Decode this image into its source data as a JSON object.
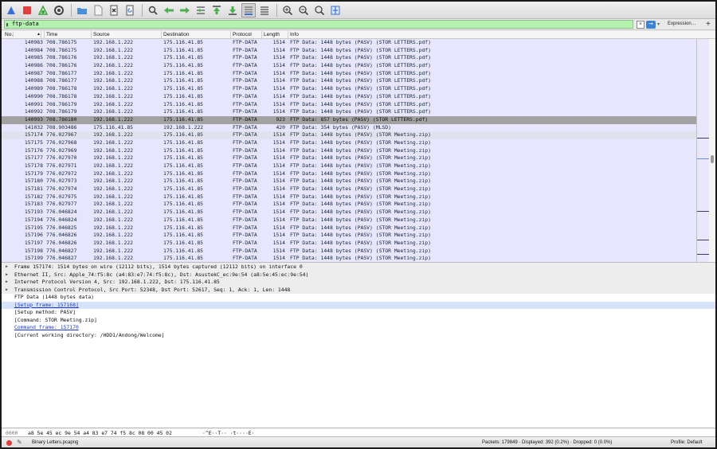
{
  "toolbar": {
    "buttons": [
      {
        "name": "shark-fin-start-icon",
        "color": "#3b6fd6"
      },
      {
        "name": "stop-capture-icon",
        "color": "#e04040"
      },
      {
        "name": "restart-capture-icon",
        "color": "#3aa63a"
      },
      {
        "name": "capture-options-icon",
        "color": "#444444"
      },
      {
        "name": "open-folder-icon",
        "color": "#4a90d9"
      },
      {
        "name": "save-file-icon",
        "color": "#7a7a7a"
      },
      {
        "name": "close-file-icon",
        "color": "#555555"
      },
      {
        "name": "reload-file-icon",
        "color": "#4a90d9"
      },
      {
        "name": "find-packet-icon",
        "color": "#444444"
      },
      {
        "name": "go-back-icon",
        "color": "#4caf50"
      },
      {
        "name": "go-forward-icon",
        "color": "#4caf50"
      },
      {
        "name": "go-to-packet-icon",
        "color": "#4caf50"
      },
      {
        "name": "go-first-packet-icon",
        "color": "#4caf50"
      },
      {
        "name": "go-last-packet-icon",
        "color": "#4caf50"
      },
      {
        "name": "auto-scroll-icon",
        "color": "#444444"
      },
      {
        "name": "colorize-icon",
        "color": "#555555"
      },
      {
        "name": "zoom-in-icon",
        "color": "#444444"
      },
      {
        "name": "zoom-out-icon",
        "color": "#444444"
      },
      {
        "name": "zoom-normal-icon",
        "color": "#444444"
      },
      {
        "name": "resize-columns-icon",
        "color": "#3b6fd6"
      }
    ]
  },
  "filter": {
    "value": "ftp-data",
    "expression_label": "Expression…",
    "plus_label": "+"
  },
  "columns": {
    "no": "No.",
    "time": "Time",
    "source": "Source",
    "destination": "Destination",
    "protocol": "Protocol",
    "length": "Length",
    "info": "Info"
  },
  "packets": [
    {
      "no": "140983",
      "time": "708.786175",
      "src": "192.168.1.222",
      "dst": "175.116.41.85",
      "proto": "FTP-DATA",
      "len": "1514",
      "info": "FTP Data: 1448 bytes (PASV) (STOR LETTERS.pdf)"
    },
    {
      "no": "140984",
      "time": "708.786175",
      "src": "192.168.1.222",
      "dst": "175.116.41.85",
      "proto": "FTP-DATA",
      "len": "1514",
      "info": "FTP Data: 1448 bytes (PASV) (STOR LETTERS.pdf)"
    },
    {
      "no": "140985",
      "time": "708.786176",
      "src": "192.168.1.222",
      "dst": "175.116.41.85",
      "proto": "FTP-DATA",
      "len": "1514",
      "info": "FTP Data: 1448 bytes (PASV) (STOR LETTERS.pdf)"
    },
    {
      "no": "140986",
      "time": "708.786176",
      "src": "192.168.1.222",
      "dst": "175.116.41.85",
      "proto": "FTP-DATA",
      "len": "1514",
      "info": "FTP Data: 1448 bytes (PASV) (STOR LETTERS.pdf)"
    },
    {
      "no": "140987",
      "time": "708.786177",
      "src": "192.168.1.222",
      "dst": "175.116.41.85",
      "proto": "FTP-DATA",
      "len": "1514",
      "info": "FTP Data: 1448 bytes (PASV) (STOR LETTERS.pdf)"
    },
    {
      "no": "140988",
      "time": "708.786177",
      "src": "192.168.1.222",
      "dst": "175.116.41.85",
      "proto": "FTP-DATA",
      "len": "1514",
      "info": "FTP Data: 1448 bytes (PASV) (STOR LETTERS.pdf)"
    },
    {
      "no": "140989",
      "time": "708.786178",
      "src": "192.168.1.222",
      "dst": "175.116.41.85",
      "proto": "FTP-DATA",
      "len": "1514",
      "info": "FTP Data: 1448 bytes (PASV) (STOR LETTERS.pdf)"
    },
    {
      "no": "140990",
      "time": "708.786178",
      "src": "192.168.1.222",
      "dst": "175.116.41.85",
      "proto": "FTP-DATA",
      "len": "1514",
      "info": "FTP Data: 1448 bytes (PASV) (STOR LETTERS.pdf)"
    },
    {
      "no": "140991",
      "time": "708.786179",
      "src": "192.168.1.222",
      "dst": "175.116.41.85",
      "proto": "FTP-DATA",
      "len": "1514",
      "info": "FTP Data: 1448 bytes (PASV) (STOR LETTERS.pdf)"
    },
    {
      "no": "140992",
      "time": "708.786179",
      "src": "192.168.1.222",
      "dst": "175.116.41.85",
      "proto": "FTP-DATA",
      "len": "1514",
      "info": "FTP Data: 1448 bytes (PASV) (STOR LETTERS.pdf)"
    },
    {
      "no": "140993",
      "time": "708.786180",
      "src": "192.168.1.222",
      "dst": "175.116.41.85",
      "proto": "FTP-DATA",
      "len": "923",
      "info": "FTP Data: 857 bytes (PASV) (STOR LETTERS.pdf)"
    },
    {
      "no": "141032",
      "time": "708.903486",
      "src": "175.116.41.85",
      "dst": "192.168.1.222",
      "proto": "FTP-DATA",
      "len": "420",
      "info": "FTP Data: 354 bytes (PASV) (MLSD)"
    },
    {
      "no": "157174",
      "time": "776.027967",
      "src": "192.168.1.222",
      "dst": "175.116.41.85",
      "proto": "FTP-DATA",
      "len": "1514",
      "info": "FTP Data: 1448 bytes (PASV) (STOR Meeting.zip)"
    },
    {
      "no": "157175",
      "time": "776.027968",
      "src": "192.168.1.222",
      "dst": "175.116.41.85",
      "proto": "FTP-DATA",
      "len": "1514",
      "info": "FTP Data: 1448 bytes (PASV) (STOR Meeting.zip)"
    },
    {
      "no": "157176",
      "time": "776.027969",
      "src": "192.168.1.222",
      "dst": "175.116.41.85",
      "proto": "FTP-DATA",
      "len": "1514",
      "info": "FTP Data: 1448 bytes (PASV) (STOR Meeting.zip)"
    },
    {
      "no": "157177",
      "time": "776.027970",
      "src": "192.168.1.222",
      "dst": "175.116.41.85",
      "proto": "FTP-DATA",
      "len": "1514",
      "info": "FTP Data: 1448 bytes (PASV) (STOR Meeting.zip)"
    },
    {
      "no": "157178",
      "time": "776.027971",
      "src": "192.168.1.222",
      "dst": "175.116.41.85",
      "proto": "FTP-DATA",
      "len": "1514",
      "info": "FTP Data: 1448 bytes (PASV) (STOR Meeting.zip)"
    },
    {
      "no": "157179",
      "time": "776.027972",
      "src": "192.168.1.222",
      "dst": "175.116.41.85",
      "proto": "FTP-DATA",
      "len": "1514",
      "info": "FTP Data: 1448 bytes (PASV) (STOR Meeting.zip)"
    },
    {
      "no": "157180",
      "time": "776.027973",
      "src": "192.168.1.222",
      "dst": "175.116.41.85",
      "proto": "FTP-DATA",
      "len": "1514",
      "info": "FTP Data: 1448 bytes (PASV) (STOR Meeting.zip)"
    },
    {
      "no": "157181",
      "time": "776.027974",
      "src": "192.168.1.222",
      "dst": "175.116.41.85",
      "proto": "FTP-DATA",
      "len": "1514",
      "info": "FTP Data: 1448 bytes (PASV) (STOR Meeting.zip)"
    },
    {
      "no": "157182",
      "time": "776.027975",
      "src": "192.168.1.222",
      "dst": "175.116.41.85",
      "proto": "FTP-DATA",
      "len": "1514",
      "info": "FTP Data: 1448 bytes (PASV) (STOR Meeting.zip)"
    },
    {
      "no": "157183",
      "time": "776.027977",
      "src": "192.168.1.222",
      "dst": "175.116.41.85",
      "proto": "FTP-DATA",
      "len": "1514",
      "info": "FTP Data: 1448 bytes (PASV) (STOR Meeting.zip)"
    },
    {
      "no": "157193",
      "time": "776.046824",
      "src": "192.168.1.222",
      "dst": "175.116.41.85",
      "proto": "FTP-DATA",
      "len": "1514",
      "info": "FTP Data: 1448 bytes (PASV) (STOR Meeting.zip)"
    },
    {
      "no": "157194",
      "time": "776.046824",
      "src": "192.168.1.222",
      "dst": "175.116.41.85",
      "proto": "FTP-DATA",
      "len": "1514",
      "info": "FTP Data: 1448 bytes (PASV) (STOR Meeting.zip)"
    },
    {
      "no": "157195",
      "time": "776.046825",
      "src": "192.168.1.222",
      "dst": "175.116.41.85",
      "proto": "FTP-DATA",
      "len": "1514",
      "info": "FTP Data: 1448 bytes (PASV) (STOR Meeting.zip)"
    },
    {
      "no": "157196",
      "time": "776.046826",
      "src": "192.168.1.222",
      "dst": "175.116.41.85",
      "proto": "FTP-DATA",
      "len": "1514",
      "info": "FTP Data: 1448 bytes (PASV) (STOR Meeting.zip)"
    },
    {
      "no": "157197",
      "time": "776.046826",
      "src": "192.168.1.222",
      "dst": "175.116.41.85",
      "proto": "FTP-DATA",
      "len": "1514",
      "info": "FTP Data: 1448 bytes (PASV) (STOR Meeting.zip)"
    },
    {
      "no": "157198",
      "time": "776.046827",
      "src": "192.168.1.222",
      "dst": "175.116.41.85",
      "proto": "FTP-DATA",
      "len": "1514",
      "info": "FTP Data: 1448 bytes (PASV) (STOR Meeting.zip)"
    },
    {
      "no": "157199",
      "time": "776.046827",
      "src": "192.168.1.222",
      "dst": "175.116.41.85",
      "proto": "FTP-DATA",
      "len": "1514",
      "info": "FTP Data: 1448 bytes (PASV) (STOR Meeting.zip)"
    }
  ],
  "selected_packet_no": "140993",
  "current_packet_no": "157174",
  "row_colors": {
    "ftp_data": "#e7e6fe",
    "selected": "#a2a2a2",
    "link": "#1d39c9"
  },
  "details": [
    {
      "text": "Frame 157174: 1514 bytes on wire (12112 bits), 1514 bytes captured (12112 bits) on interface 0",
      "kind": "top"
    },
    {
      "text": "Ethernet II, Src: Apple_74:f5:8c (a4:83:e7:74:f5:8c), Dst: AsustekC_ec:9e:54 (a8:5e:45:ec:9e:54)",
      "kind": "top"
    },
    {
      "text": "Internet Protocol Version 4, Src: 192.168.1.222, Dst: 175.116.41.85",
      "kind": "top"
    },
    {
      "text": "Transmission Control Protocol, Src Port: 52348, Dst Port: 52617, Seq: 1, Ack: 1, Len: 1448",
      "kind": "top"
    },
    {
      "text": "FTP Data (1448 bytes data)",
      "kind": "plain"
    },
    {
      "text": "[Setup frame: 157168]",
      "kind": "link"
    },
    {
      "text": "[Setup method: PASV]",
      "kind": "plain"
    },
    {
      "text": "[Command: STOR Meeting.zip]",
      "kind": "plain"
    },
    {
      "text": "Command frame: 157170",
      "kind": "link"
    },
    {
      "text": "[Current working directory: /HDD1/Andong/Welcome]",
      "kind": "plain"
    }
  ],
  "bytes": {
    "offset": "0000",
    "hex": "a8 5e 45 ec 9e 54 a4 83  e7 74 f5 8c 08 00 45 02",
    "ascii": "·^E··T··  ·t····E·"
  },
  "status": {
    "file": "Binary Letters.pcapng",
    "packets": "Packets: 179849 · Displayed: 392 (0.2%) · Dropped: 0 (0.0%)",
    "profile": "Profile: Default"
  }
}
